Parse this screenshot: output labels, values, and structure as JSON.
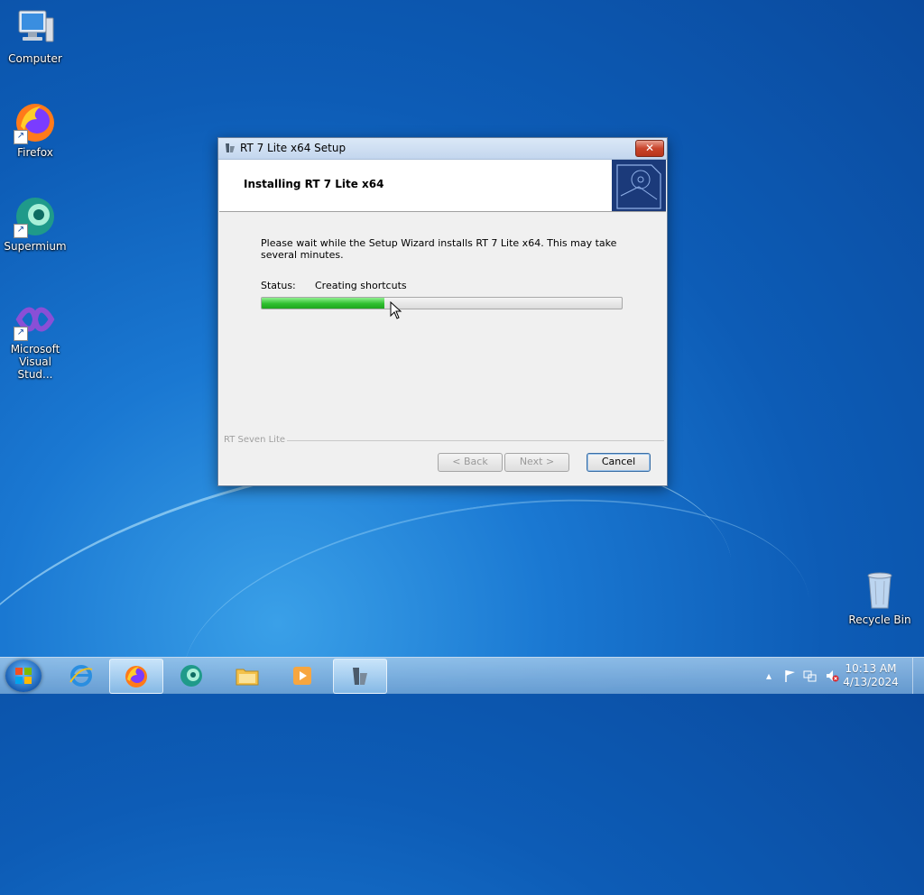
{
  "desktop": {
    "icons": [
      {
        "label": "Computer",
        "icon": "computer-icon"
      },
      {
        "label": "Firefox",
        "icon": "firefox-icon"
      },
      {
        "label": "Supermium",
        "icon": "supermium-icon"
      },
      {
        "label": "Microsoft Visual Stud...",
        "icon": "visual-studio-icon"
      },
      {
        "label": "Recycle Bin",
        "icon": "recycle-bin-icon"
      }
    ]
  },
  "window": {
    "title": "RT 7 Lite x64 Setup",
    "close_label": "✕",
    "header_title": "Installing RT 7 Lite x64",
    "message": "Please wait while the Setup Wizard installs RT 7 Lite x64.  This may take several minutes.",
    "status_label": "Status:",
    "status_value": "Creating shortcuts",
    "progress": 0.34,
    "brand": "RT Seven Lite",
    "buttons": {
      "back": "< Back",
      "next": "Next >",
      "cancel": "Cancel"
    },
    "colors": {
      "progress": "#2fbf2f",
      "banner": "#1b3a7a",
      "close": "#c9452c"
    }
  },
  "taskbar": {
    "items": [
      {
        "icon": "internet-explorer-icon",
        "active": false
      },
      {
        "icon": "firefox-icon",
        "active": true
      },
      {
        "icon": "supermium-icon",
        "active": false
      },
      {
        "icon": "file-explorer-icon",
        "active": false
      },
      {
        "icon": "media-player-icon",
        "active": false
      },
      {
        "icon": "rt7lite-setup-icon",
        "active": true
      }
    ],
    "tray_icons": [
      "show-hidden-icons-icon",
      "action-center-flag-icon",
      "network-icon",
      "volume-muted-icon"
    ],
    "clock": {
      "time": "10:13 AM",
      "date": "4/13/2024"
    }
  }
}
